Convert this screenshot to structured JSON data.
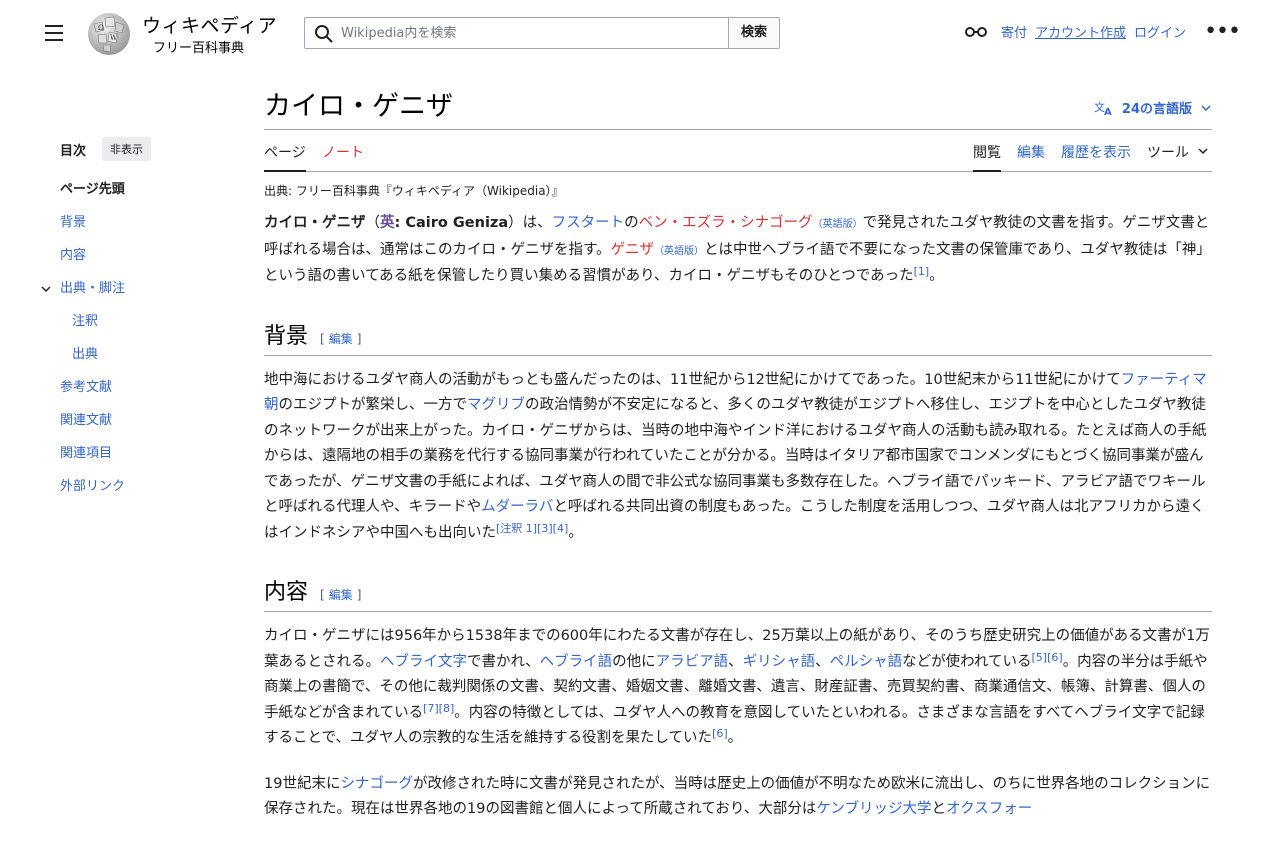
{
  "header": {
    "logo_word": "ウィキペディア",
    "logo_tagline": "フリー百科事典",
    "search_placeholder": "Wikipedia内を検索",
    "search_button": "検索",
    "donate": "寄付",
    "create_account": "アカウント作成",
    "login": "ログイン"
  },
  "toc": {
    "title": "目次",
    "hide": "非表示",
    "items": [
      "ページ先頭",
      "背景",
      "内容",
      "出典・脚注",
      "注釈",
      "出典",
      "参考文献",
      "関連文献",
      "関連項目",
      "外部リンク"
    ]
  },
  "page": {
    "title": "カイロ・ゲニザ",
    "languages": "24の言語版",
    "tab_page": "ページ",
    "tab_talk": "ノート",
    "tab_read": "閲覧",
    "tab_edit": "編集",
    "tab_history": "履歴を表示",
    "tab_tools": "ツール",
    "subtitle": "出典: フリー百科事典『ウィキペディア（Wikipedia）』"
  },
  "intro": {
    "t1": "カイロ・ゲニザ",
    "t2": "（",
    "t3": "英",
    "t4": ": Cairo Geniza",
    "t5": "）は、",
    "l1": "フスタート",
    "t6": "の",
    "l2": "ベン・エズラ・シナゴーグ",
    "l3": "（英語版）",
    "t7": "で発見されたユダヤ教徒の文書を指す。ゲニザ文書と呼ばれる場合は、通常はこのカイロ・ゲニザを指す。",
    "l4": "ゲニザ",
    "l5": "（英語版）",
    "t8": "とは中世ヘブライ語で不要になった文書の保管庫であり、ユダヤ教徒は「神」という語の書いてある紙を保管したり買い集める習慣があり、カイロ・ゲニザもそのひとつであった",
    "r1": "[1]",
    "t9": "。"
  },
  "sections": {
    "edit": "編集",
    "bracket_open": "[",
    "bracket_close": "]",
    "s1_title": "背景",
    "s2_title": "内容"
  },
  "background": {
    "t1": "地中海におけるユダヤ商人の活動がもっとも盛んだったのは、11世紀から12世紀にかけてであった。10世紀末から11世紀にかけて",
    "l1": "ファーティマ朝",
    "t2": "のエジプトが繁栄し、一方で",
    "l2": "マグリブ",
    "t3": "の政治情勢が不安定になると、多くのユダヤ教徒がエジプトへ移住し、エジプトを中心としたユダヤ教徒のネットワークが出来上がった。カイロ・ゲニザからは、当時の地中海やインド洋におけるユダヤ商人の活動も読み取れる。たとえば商人の手紙からは、遠隔地の相手の業務を代行する協同事業が行われていたことが分かる。当時はイタリア都市国家でコンメンダにもとづく協同事業が盛んであったが、ゲニザ文書の手紙によれば、ユダヤ商人の間で非公式な協同事業も多数存在した。ヘブライ語でパッキード、アラビア語でワキールと呼ばれる代理人や、キラードや",
    "l3": "ムダーラバ",
    "t4": "と呼ばれる共同出資の制度もあった。こうした制度を活用しつつ、ユダヤ商人は北アフリカから遠くはインドネシアや中国へも出向いた",
    "r1": "[注釈 1]",
    "r2": "[3]",
    "r3": "[4]",
    "t5": "。"
  },
  "contents": {
    "t1": "カイロ・ゲニザには956年から1538年までの600年にわたる文書が存在し、25万葉以上の紙があり、そのうち歴史研究上の価値がある文書が1万葉あるとされる。",
    "l1": "ヘブライ文字",
    "t2": "で書かれ、",
    "l2": "ヘブライ語",
    "t3": "の他に",
    "l3": "アラビア語",
    "t4": "、",
    "l4": "ギリシャ語",
    "t5": "、",
    "l5": "ペルシャ語",
    "t6": "などが使われている",
    "r1": "[5]",
    "r2": "[6]",
    "t7": "。内容の半分は手紙や商業上の書簡で、その他に裁判関係の文書、契約文書、婚姻文書、離婚文書、遺言、財産証書、売買契約書、商業通信文、帳簿、計算書、個人の手紙などが含まれている",
    "r3": "[7]",
    "r4": "[8]",
    "t8": "。内容の特徴としては、ユダヤ人への教育を意図していたといわれる。さまざまな言語をすべてヘブライ文字で記録することで、ユダヤ人の宗教的な生活を維持する役割を果たしていた",
    "r5": "[6]",
    "t9": "。"
  },
  "contents2": {
    "t1": "19世紀末に",
    "l1": "シナゴーグ",
    "t2": "が改修された時に文書が発見されたが、当時は歴史上の価値が不明なため欧米に流出し、のちに世界各地のコレクションに保存された。現在は世界各地の19の図書館と個人によって所蔵されており、大部分は",
    "l2": "ケンブリッジ大学",
    "t3": "と",
    "l3": "オクスフォー"
  }
}
